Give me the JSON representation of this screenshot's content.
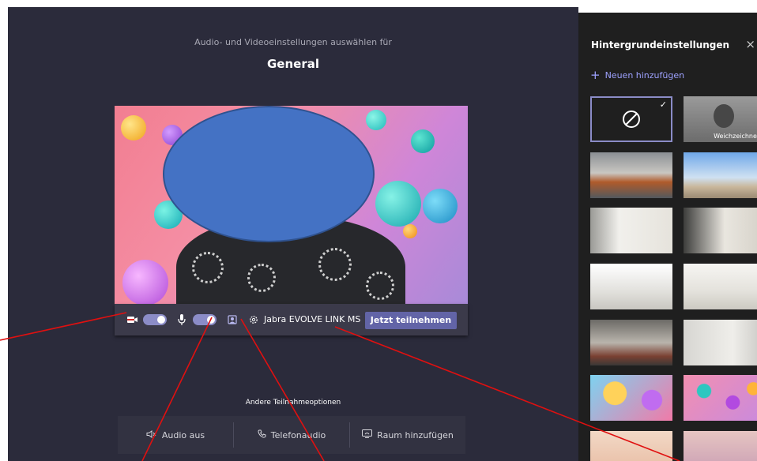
{
  "meeting": {
    "subtitle": "Audio- und Videoeinstellungen auswählen für",
    "title": "General"
  },
  "controls": {
    "camera_enabled": true,
    "mic_enabled": true,
    "device_name": "Jabra EVOLVE LINK MS",
    "join_label": "Jetzt teilnehmen",
    "icons": [
      "camera-off-icon",
      "microphone-icon",
      "background-effects-icon",
      "gear-icon"
    ]
  },
  "other_options": {
    "title": "Andere Teilnahmeoptionen",
    "items": [
      {
        "icon": "speaker-off-icon",
        "label": "Audio aus"
      },
      {
        "icon": "phone-icon",
        "label": "Telefonaudio"
      },
      {
        "icon": "cast-icon",
        "label": "Raum hinzufügen"
      }
    ]
  },
  "background_panel": {
    "title": "Hintergrundeinstellungen",
    "add_new_label": "Neuen hinzufügen",
    "blur_label": "Weichzeichnen",
    "selected": "none",
    "accent_color": "#8b8cc7"
  },
  "colors": {
    "join_button": "#6264a7",
    "annotation_lines": "#e01010",
    "redaction_oval": "#4472c4"
  }
}
